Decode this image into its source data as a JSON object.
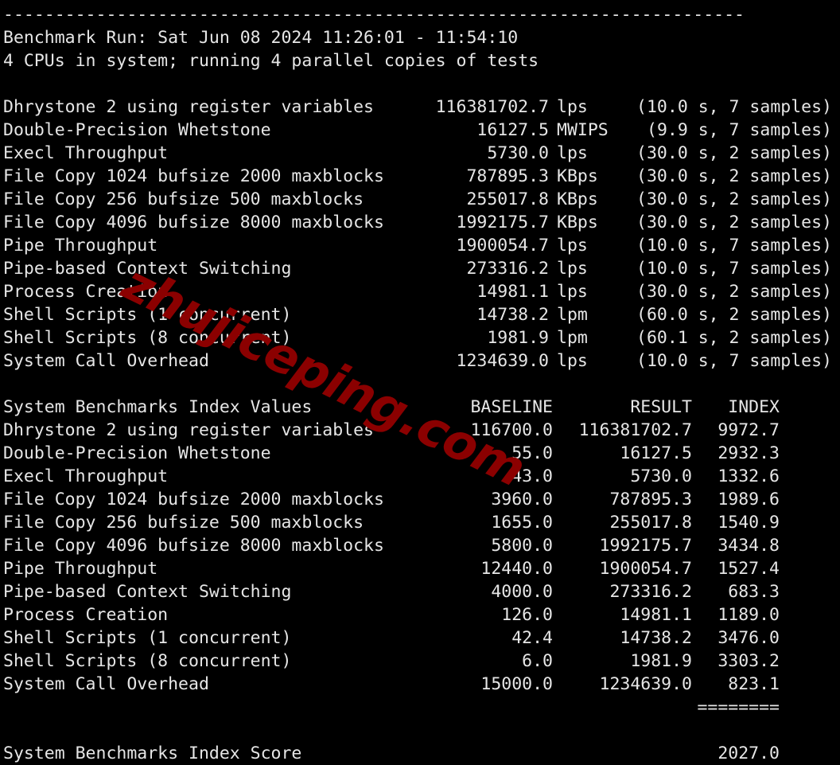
{
  "terminal": {
    "separator": "------------------------------------------------------------------------",
    "header_lines": [
      "Benchmark Run: Sat Jun 08 2024 11:26:01 - 11:54:10",
      "4 CPUs in system; running 4 parallel copies of tests"
    ],
    "score_separator": "========",
    "watermark": "zhujiceping.com",
    "colors": {
      "background": "#000000",
      "text": "#e6e6e6",
      "watermark": "#8B0000"
    }
  },
  "raw_results": {
    "rows": [
      {
        "label": "Dhrystone 2 using register variables",
        "value": "116381702.7",
        "unit": "lps",
        "samples": "(10.0 s, 7 samples)"
      },
      {
        "label": "Double-Precision Whetstone",
        "value": "16127.5",
        "unit": "MWIPS",
        "samples": "(9.9 s, 7 samples)"
      },
      {
        "label": "Execl Throughput",
        "value": "5730.0",
        "unit": "lps",
        "samples": "(30.0 s, 2 samples)"
      },
      {
        "label": "File Copy 1024 bufsize 2000 maxblocks",
        "value": "787895.3",
        "unit": "KBps",
        "samples": "(30.0 s, 2 samples)"
      },
      {
        "label": "File Copy 256 bufsize 500 maxblocks",
        "value": "255017.8",
        "unit": "KBps",
        "samples": "(30.0 s, 2 samples)"
      },
      {
        "label": "File Copy 4096 bufsize 8000 maxblocks",
        "value": "1992175.7",
        "unit": "KBps",
        "samples": "(30.0 s, 2 samples)"
      },
      {
        "label": "Pipe Throughput",
        "value": "1900054.7",
        "unit": "lps",
        "samples": "(10.0 s, 7 samples)"
      },
      {
        "label": "Pipe-based Context Switching",
        "value": "273316.2",
        "unit": "lps",
        "samples": "(10.0 s, 7 samples)"
      },
      {
        "label": "Process Creation",
        "value": "14981.1",
        "unit": "lps",
        "samples": "(30.0 s, 2 samples)"
      },
      {
        "label": "Shell Scripts (1 concurrent)",
        "value": "14738.2",
        "unit": "lpm",
        "samples": "(60.0 s, 2 samples)"
      },
      {
        "label": "Shell Scripts (8 concurrent)",
        "value": "1981.9",
        "unit": "lpm",
        "samples": "(60.1 s, 2 samples)"
      },
      {
        "label": "System Call Overhead",
        "value": "1234639.0",
        "unit": "lps",
        "samples": "(10.0 s, 7 samples)"
      }
    ]
  },
  "index_table": {
    "title": "System Benchmarks Index Values",
    "columns": {
      "baseline": "BASELINE",
      "result": "RESULT",
      "index": "INDEX"
    },
    "rows": [
      {
        "label": "Dhrystone 2 using register variables",
        "baseline": "116700.0",
        "result": "116381702.7",
        "index": "9972.7"
      },
      {
        "label": "Double-Precision Whetstone",
        "baseline": "55.0",
        "result": "16127.5",
        "index": "2932.3"
      },
      {
        "label": "Execl Throughput",
        "baseline": "43.0",
        "result": "5730.0",
        "index": "1332.6"
      },
      {
        "label": "File Copy 1024 bufsize 2000 maxblocks",
        "baseline": "3960.0",
        "result": "787895.3",
        "index": "1989.6"
      },
      {
        "label": "File Copy 256 bufsize 500 maxblocks",
        "baseline": "1655.0",
        "result": "255017.8",
        "index": "1540.9"
      },
      {
        "label": "File Copy 4096 bufsize 8000 maxblocks",
        "baseline": "5800.0",
        "result": "1992175.7",
        "index": "3434.8"
      },
      {
        "label": "Pipe Throughput",
        "baseline": "12440.0",
        "result": "1900054.7",
        "index": "1527.4"
      },
      {
        "label": "Pipe-based Context Switching",
        "baseline": "4000.0",
        "result": "273316.2",
        "index": "683.3"
      },
      {
        "label": "Process Creation",
        "baseline": "126.0",
        "result": "14981.1",
        "index": "1189.0"
      },
      {
        "label": "Shell Scripts (1 concurrent)",
        "baseline": "42.4",
        "result": "14738.2",
        "index": "3476.0"
      },
      {
        "label": "Shell Scripts (8 concurrent)",
        "baseline": "6.0",
        "result": "1981.9",
        "index": "3303.2"
      },
      {
        "label": "System Call Overhead",
        "baseline": "15000.0",
        "result": "1234639.0",
        "index": "823.1"
      }
    ]
  },
  "final_score": {
    "label": "System Benchmarks Index Score",
    "value": "2027.0"
  }
}
